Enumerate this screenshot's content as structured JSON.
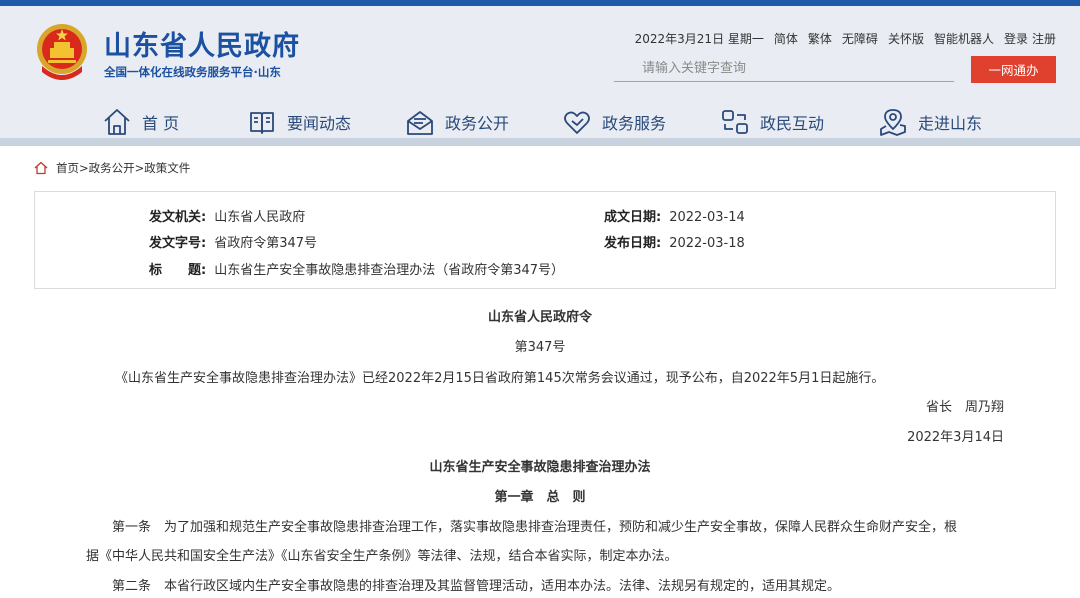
{
  "header": {
    "site_title": "山东省人民政府",
    "site_subtitle": "全国一体化在线政务服务平台·山东",
    "date": "2022年3月21日 星期一",
    "links": [
      "简体",
      "繁体",
      "无障碍",
      "关怀版",
      "智能机器人"
    ],
    "login": "登录",
    "register": "注册",
    "search_placeholder": "请输入关键字查询",
    "search_button": "一网通办",
    "brand_blue": "#1c50a0",
    "accent_red": "#e0412f"
  },
  "nav": {
    "items": [
      {
        "label": "首 页",
        "icon": "home-icon"
      },
      {
        "label": "要闻动态",
        "icon": "book-icon"
      },
      {
        "label": "政务公开",
        "icon": "mail-tray-icon"
      },
      {
        "label": "政务服务",
        "icon": "heart-icon"
      },
      {
        "label": "政民互动",
        "icon": "interaction-icon"
      },
      {
        "label": "走进山东",
        "icon": "map-pin-icon"
      }
    ]
  },
  "breadcrumb": {
    "items": [
      "首页",
      "政务公开",
      "政策文件"
    ],
    "separator": ">"
  },
  "meta": {
    "issuer_label": "发文机关:",
    "issuer": "山东省人民政府",
    "doc_no_label": "发文字号:",
    "doc_no": "省政府令第347号",
    "title_label": "标　　题:",
    "title": "山东省生产安全事故隐患排查治理办法（省政府令第347号）",
    "written_label": "成文日期:",
    "written_date": "2022-03-14",
    "published_label": "发布日期:",
    "published_date": "2022-03-18"
  },
  "document": {
    "order_title": "山东省人民政府令",
    "order_no": "第347号",
    "announcement": "《山东省生产安全事故隐患排查治理办法》已经2022年2月15日省政府第145次常务会议通过，现予公布，自2022年5月1日起施行。",
    "signer": "省长　周乃翔",
    "sign_date": "2022年3月14日",
    "law_title": "山东省生产安全事故隐患排查治理办法",
    "chapter1": "第一章　总　则",
    "article1_line1": "第一条　为了加强和规范生产安全事故隐患排查治理工作，落实事故隐患排查治理责任，预防和减少生产安全事故，保障人民群众生命财产安全，根",
    "article1_line2": "据《中华人民共和国安全生产法》《山东省安全生产条例》等法律、法规，结合本省实际，制定本办法。",
    "article2": "第二条　本省行政区域内生产安全事故隐患的排查治理及其监督管理活动，适用本办法。法律、法规另有规定的，适用其规定。"
  }
}
